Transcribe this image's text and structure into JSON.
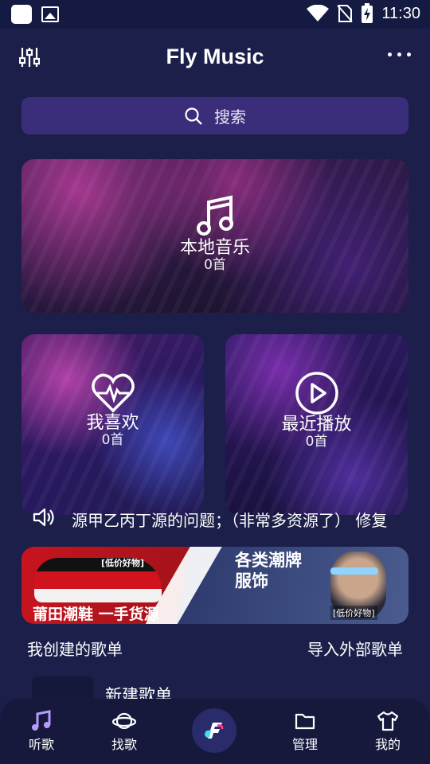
{
  "status_bar": {
    "time": "11:30",
    "icons": [
      "app-square-icon",
      "image-icon",
      "wifi-icon",
      "no-sim-icon",
      "battery-charging-icon"
    ]
  },
  "app_bar": {
    "title": "Fly Music",
    "left_icon": "equalizer-icon",
    "right_icon": "more-horizontal-icon"
  },
  "search": {
    "placeholder": "搜索",
    "icon": "search-icon"
  },
  "cards": {
    "local": {
      "title": "本地音乐",
      "count": "0首",
      "icon": "music-note-icon"
    },
    "favorites": {
      "title": "我喜欢",
      "count": "0首",
      "icon": "heart-pulse-icon"
    },
    "recent": {
      "title": "最近播放",
      "count": "0首",
      "icon": "play-circle-icon"
    }
  },
  "notice": {
    "icon": "speaker-icon",
    "text": "源甲乙丙丁源的问题；（非常多资源了） 修复"
  },
  "banner": {
    "left_tag": "[低价好物]",
    "left_text": "莆田潮鞋 一手货源",
    "right_title_line1": "各类潮牌",
    "right_title_line2": "服饰",
    "right_tag": "[低价好物]"
  },
  "section": {
    "my_playlists": "我创建的歌单",
    "import_playlist": "导入外部歌单"
  },
  "playlists": [
    {
      "name": "新建歌单"
    }
  ],
  "bottom_nav": {
    "items": [
      {
        "label": "听歌",
        "icon": "music-note-icon",
        "active": true
      },
      {
        "label": "找歌",
        "icon": "planet-icon"
      },
      {
        "label": "",
        "icon": "app-logo-icon"
      },
      {
        "label": "管理",
        "icon": "folder-icon"
      },
      {
        "label": "我的",
        "icon": "tshirt-icon"
      }
    ]
  },
  "colors": {
    "background": "#1b1f4a",
    "search_bg": "#3a2e7a",
    "nav_active": "#b49bff"
  }
}
